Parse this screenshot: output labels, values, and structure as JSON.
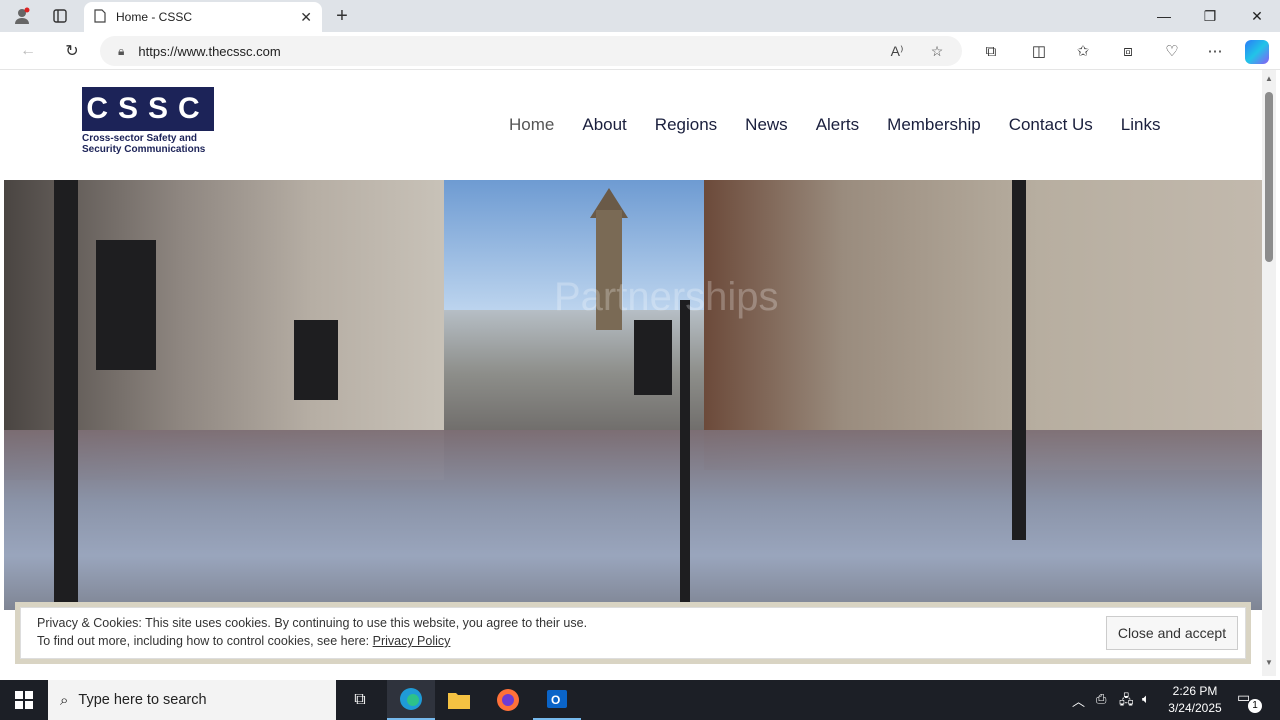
{
  "browser": {
    "tab_title": "Home - CSSC",
    "url": "https://www.thecssc.com"
  },
  "site": {
    "logo_letters": "CSSC",
    "logo_tagline": "Cross-sector Safety and Security Communications",
    "nav": [
      "Home",
      "About",
      "Regions",
      "News",
      "Alerts",
      "Membership",
      "Contact Us",
      "Links"
    ],
    "active_nav": "Home",
    "hero_overlay_text": "Partnerships"
  },
  "cookie_notice": {
    "line1": "Privacy & Cookies: This site uses cookies. By continuing to use this website, you agree to their use.",
    "line2_prefix": "To find out more, including how to control cookies, see here: ",
    "link": "Privacy Policy",
    "button": "Close and accept"
  },
  "taskbar": {
    "search_placeholder": "Type here to search",
    "time": "2:26 PM",
    "date": "3/24/2025",
    "notification_count": "1"
  },
  "colors": {
    "brand_navy": "#1c2358",
    "taskbar": "#1c1f26"
  }
}
